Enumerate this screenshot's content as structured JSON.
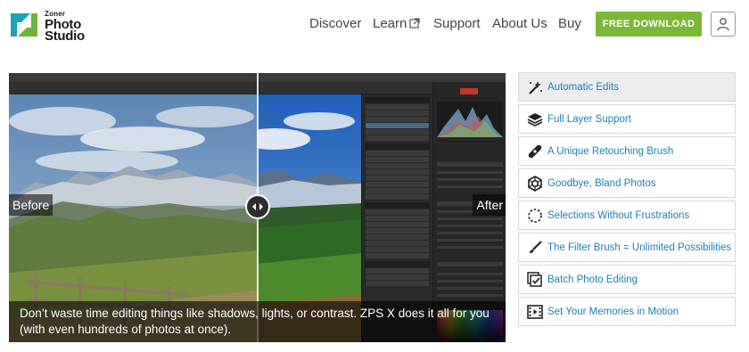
{
  "brand": {
    "line1": "Zoner",
    "line2": "Photo",
    "line3": "Studio",
    "colors": {
      "teal": "#1ea0b8",
      "green": "#6cb33e",
      "dark": "#1b1b1b"
    }
  },
  "nav": {
    "discover": "Discover",
    "learn": "Learn",
    "learn_icon": "external-link-icon",
    "support": "Support",
    "about": "About Us",
    "buy": "Buy"
  },
  "cta": {
    "label": "FREE DOWNLOAD",
    "color": "#7ab838"
  },
  "user_icon": "user-icon",
  "viewer": {
    "before_label": "Before",
    "after_label": "After",
    "handle_icon": "left-right-arrows-icon",
    "caption": "Don’t waste time editing things like shadows, lights, or contrast. ZPS X does it all for you (with even hundreds of photos at once)."
  },
  "features": [
    {
      "label": "Automatic Edits",
      "icon": "magic-wand-icon",
      "active": true
    },
    {
      "label": "Full Layer Support",
      "icon": "layers-icon",
      "active": false
    },
    {
      "label": "A Unique Retouching Brush",
      "icon": "bandage-icon",
      "active": false
    },
    {
      "label": "Goodbye, Bland Photos",
      "icon": "color-wheel-icon",
      "active": false
    },
    {
      "label": "Selections Without Frustrations",
      "icon": "dashed-circle-icon",
      "active": false
    },
    {
      "label": "The Filter Brush = Unlimited Possibilities",
      "icon": "brush-icon",
      "active": false
    },
    {
      "label": "Batch Photo Editing",
      "icon": "batch-check-icon",
      "active": false
    },
    {
      "label": "Set Your Memories in Motion",
      "icon": "film-icon",
      "active": false
    }
  ],
  "accent_link_color": "#1a7fb5"
}
